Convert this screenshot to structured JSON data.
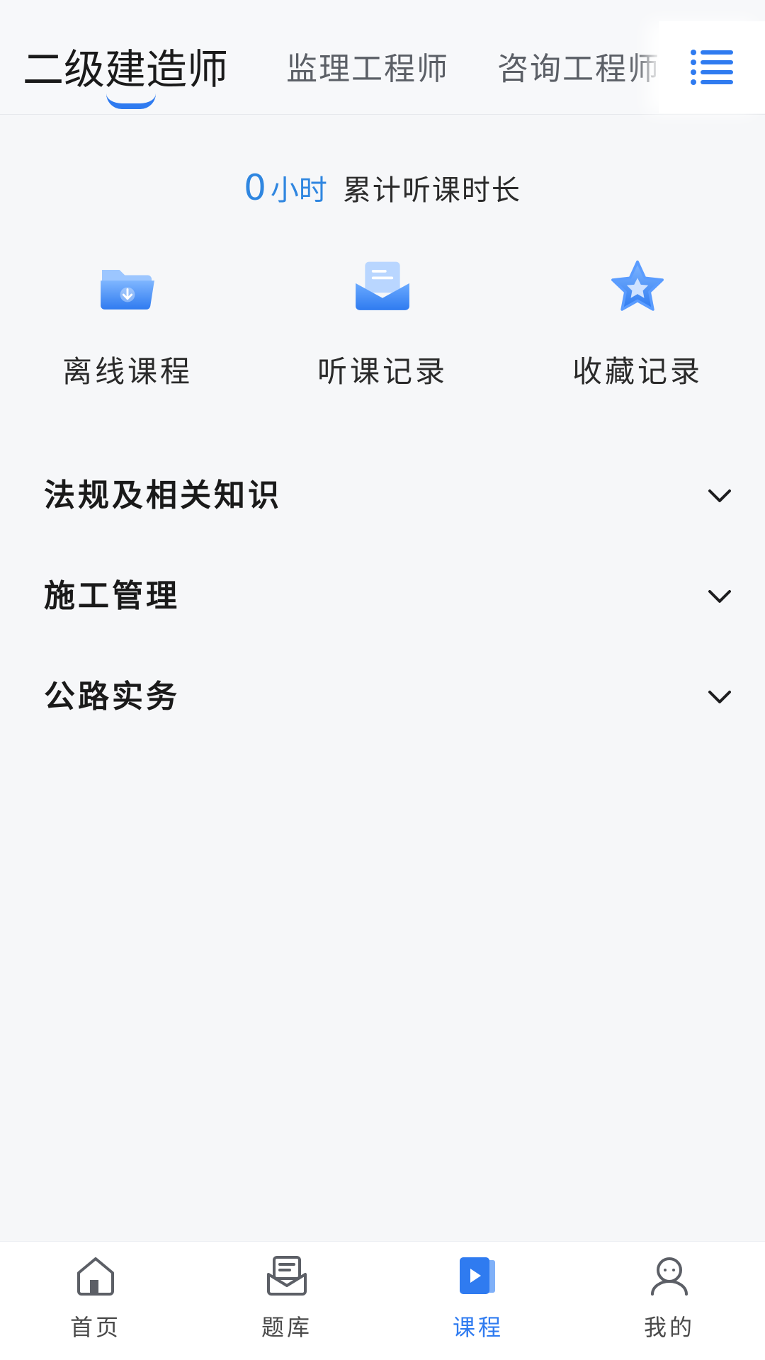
{
  "header": {
    "tabs": [
      {
        "label": "二级建造师",
        "active": true
      },
      {
        "label": "监理工程师",
        "active": false
      },
      {
        "label": "咨询工程师",
        "active": false
      }
    ],
    "menu_icon": "list-menu-icon"
  },
  "study": {
    "hours_value": "0",
    "hours_unit": "小时",
    "caption": "累计听课时长"
  },
  "actions": [
    {
      "label": "离线课程",
      "icon": "folder-download-icon"
    },
    {
      "label": "听课记录",
      "icon": "mail-record-icon"
    },
    {
      "label": "收藏记录",
      "icon": "star-icon"
    }
  ],
  "subjects": [
    {
      "label": "法规及相关知识",
      "expanded": false
    },
    {
      "label": "施工管理",
      "expanded": false
    },
    {
      "label": "公路实务",
      "expanded": false
    }
  ],
  "bottom_nav": [
    {
      "label": "首页",
      "icon": "home-icon",
      "active": false
    },
    {
      "label": "题库",
      "icon": "question-bank-icon",
      "active": false
    },
    {
      "label": "课程",
      "icon": "course-play-icon",
      "active": true
    },
    {
      "label": "我的",
      "icon": "user-icon",
      "active": false
    }
  ],
  "colors": {
    "accent": "#2f7bf0",
    "hours_blue": "#2f86e0",
    "background": "#f6f7f9",
    "text": "#1a1a1a"
  }
}
